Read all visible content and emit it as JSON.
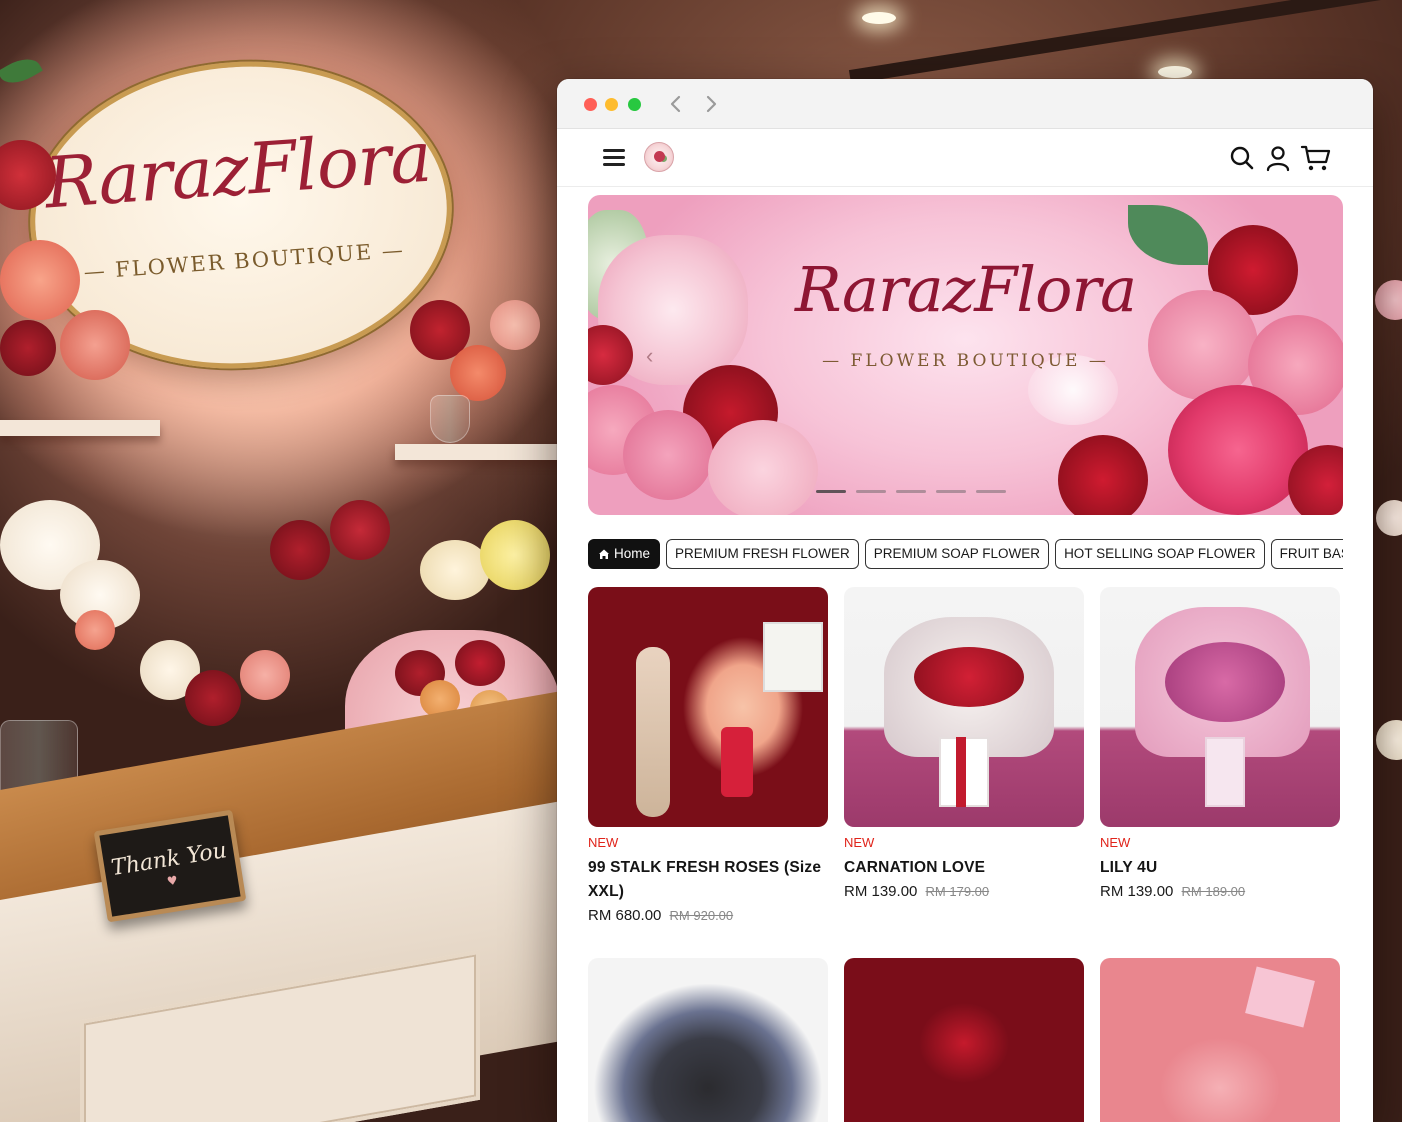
{
  "shop_sign": {
    "brand": "RarazFlora",
    "subtitle": "— FLOWER BOUTIQUE —"
  },
  "counter_card": {
    "text": "Thank You",
    "heart": "♥"
  },
  "browser": {
    "controls": [
      "close",
      "minimize",
      "maximize"
    ],
    "nav": {
      "back_icon": "chevron-left-icon",
      "forward_icon": "chevron-right-icon"
    }
  },
  "header": {
    "menu_icon": "hamburger-menu-icon",
    "logo_icon": "flower-logo-icon",
    "actions": [
      "search-icon",
      "user-icon",
      "cart-icon"
    ]
  },
  "hero": {
    "title": "RarazFlora",
    "subtitle": "— FLOWER BOUTIQUE —",
    "prev_arrow": "‹",
    "slides_count": 5,
    "active_slide": 1
  },
  "categories": [
    {
      "label": "Home",
      "icon": "home-icon",
      "active": true
    },
    {
      "label": "PREMIUM FRESH FLOWER",
      "active": false
    },
    {
      "label": "PREMIUM SOAP FLOWER",
      "active": false
    },
    {
      "label": "HOT SELLING SOAP FLOWER",
      "active": false
    },
    {
      "label": "FRUIT BASKET",
      "active": false
    }
  ],
  "products": [
    {
      "badge": "NEW",
      "name": "99 STALK FRESH ROSES (Size XXL)",
      "price": "RM 680.00",
      "old_price": "RM 920.00"
    },
    {
      "badge": "NEW",
      "name": "CARNATION LOVE",
      "price": "RM 139.00",
      "old_price": "RM 179.00"
    },
    {
      "badge": "NEW",
      "name": "LILY 4U",
      "price": "RM 139.00",
      "old_price": "RM 189.00"
    }
  ],
  "colors": {
    "accent_red": "#e0241b",
    "brand_burgundy": "#8e1633",
    "pill_active_bg": "#111111"
  }
}
